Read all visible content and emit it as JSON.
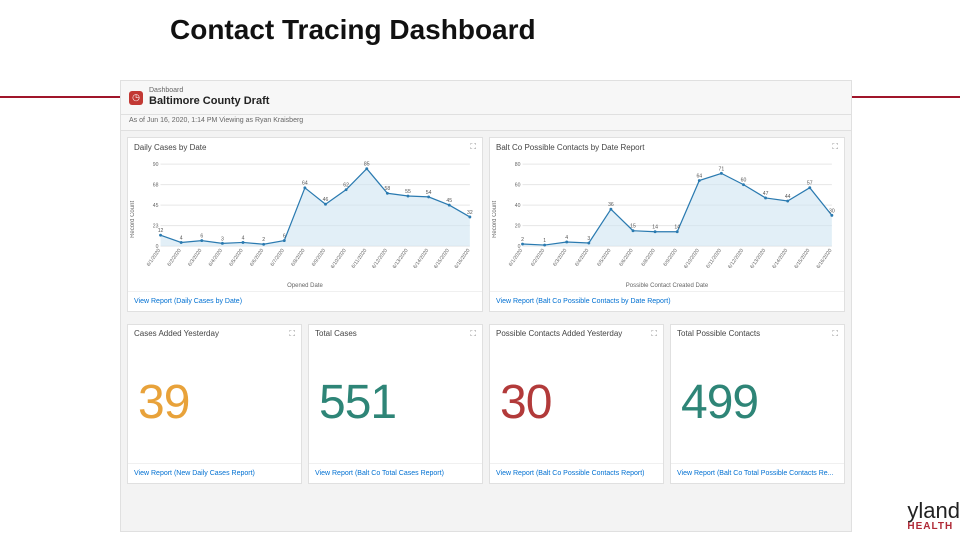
{
  "slide": {
    "title": "Contact Tracing Dashboard"
  },
  "header": {
    "eyebrow": "Dashboard",
    "title": "Baltimore County Draft",
    "as_of": "As of Jun 16, 2020, 1:14 PM Viewing as Ryan Kraisberg"
  },
  "charts": {
    "left": {
      "title": "Daily Cases by Date",
      "ylabel": "Record Count",
      "xlabel": "Opened Date",
      "view_link": "View Report (Daily Cases by Date)"
    },
    "right": {
      "title": "Balt Co Possible Contacts by Date Report",
      "ylabel": "Record Count",
      "xlabel": "Possible Contact Created Date",
      "view_link": "View Report (Balt Co Possible Contacts by Date Report)"
    }
  },
  "chart_data": [
    {
      "type": "line",
      "title": "Daily Cases by Date",
      "xlabel": "Opened Date",
      "ylabel": "Record Count",
      "ylim": [
        0,
        90
      ],
      "categories": [
        "6/1/2020",
        "6/2/2020",
        "6/3/2020",
        "6/4/2020",
        "6/5/2020",
        "6/6/2020",
        "6/7/2020",
        "6/8/2020",
        "6/9/2020",
        "6/10/2020",
        "6/11/2020",
        "6/12/2020",
        "6/13/2020",
        "6/14/2020",
        "6/15/2020",
        "6/16/2020"
      ],
      "values": [
        12,
        4,
        6,
        3,
        4,
        2,
        6,
        64,
        46,
        62,
        85,
        58,
        55,
        54,
        45,
        32
      ]
    },
    {
      "type": "line",
      "title": "Balt Co Possible Contacts by Date Report",
      "xlabel": "Possible Contact Created Date",
      "ylabel": "Record Count",
      "ylim": [
        0,
        80
      ],
      "categories": [
        "6/1/2020",
        "6/2/2020",
        "6/3/2020",
        "6/4/2020",
        "6/5/2020",
        "6/6/2020",
        "6/8/2020",
        "6/9/2020",
        "6/10/2020",
        "6/11/2020",
        "6/12/2020",
        "6/13/2020",
        "6/14/2020",
        "6/15/2020",
        "6/16/2020"
      ],
      "values": [
        2,
        1,
        4,
        3,
        36,
        15,
        14,
        14,
        64,
        71,
        60,
        47,
        44,
        57,
        30
      ]
    }
  ],
  "kpis": [
    {
      "title": "Cases Added Yesterday",
      "value": "39",
      "color": "#e8a23a",
      "link": "View Report (New Daily Cases Report)"
    },
    {
      "title": "Total Cases",
      "value": "551",
      "color": "#2e8577",
      "link": "View Report (Balt Co Total Cases Report)"
    },
    {
      "title": "Possible Contacts Added Yesterday",
      "value": "30",
      "color": "#b23a3a",
      "link": "View Report (Balt Co Possible Contacts Report)"
    },
    {
      "title": "Total Possible Contacts",
      "value": "499",
      "color": "#2e8577",
      "link": "View Report (Balt Co Total Possible Contacts Re..."
    }
  ],
  "brand": {
    "l1": "yland",
    "l2": "HEALTH"
  }
}
